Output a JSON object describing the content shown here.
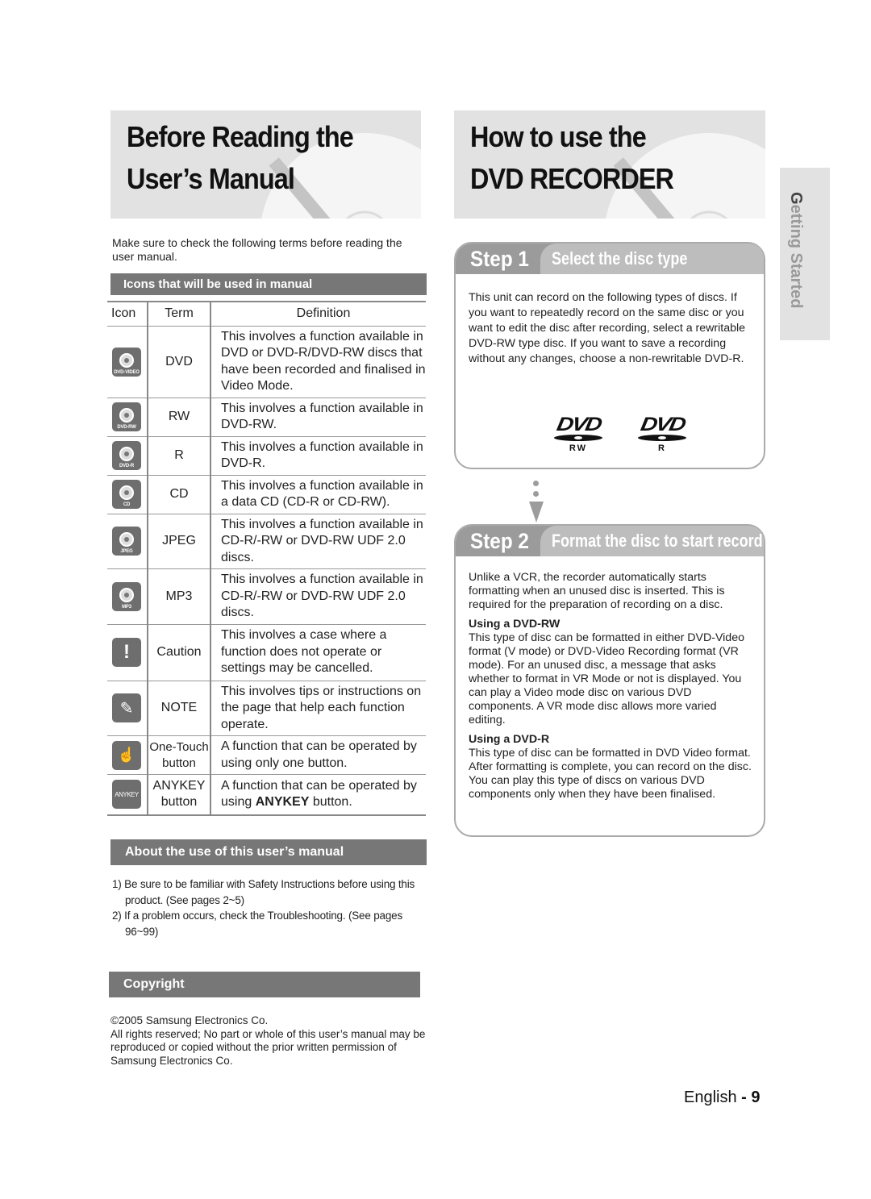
{
  "left_banner": {
    "line1": "Before Reading the",
    "line2": "User’s Manual"
  },
  "right_banner": {
    "line1": "How to use the",
    "line2": "DVD RECORDER"
  },
  "intro": "Make sure to check the following terms before reading the user manual.",
  "icons_section": {
    "title": "Icons that will be used in manual",
    "headers": {
      "icon": "Icon",
      "term": "Term",
      "definition": "Definition"
    },
    "rows": [
      {
        "icon": "dvd-video-disc-icon",
        "badge": "DVD-VIDEO",
        "term": "DVD",
        "definition": "This involves a function available in DVD or DVD-R/DVD-RW discs that have been recorded and finalised in Video Mode."
      },
      {
        "icon": "dvd-rw-disc-icon",
        "badge": "DVD-RW",
        "term": "RW",
        "definition": "This involves a function available in DVD-RW."
      },
      {
        "icon": "dvd-r-disc-icon",
        "badge": "DVD-R",
        "term": "R",
        "definition": "This involves a function available in DVD-R."
      },
      {
        "icon": "cd-disc-icon",
        "badge": "CD",
        "term": "CD",
        "definition": "This involves a function available in a data CD (CD-R or CD-RW)."
      },
      {
        "icon": "jpeg-disc-icon",
        "badge": "JPEG",
        "term": "JPEG",
        "definition": "This involves a function available in CD-R/-RW or DVD-RW UDF 2.0 discs."
      },
      {
        "icon": "mp3-disc-icon",
        "badge": "MP3",
        "term": "MP3",
        "definition": "This involves a function available in CD-R/-RW or DVD-RW UDF 2.0 discs."
      },
      {
        "icon": "caution-icon",
        "glyph": "!",
        "term": "Caution",
        "definition": "This involves a case where a function does not operate or settings may be cancelled."
      },
      {
        "icon": "note-pencil-icon",
        "glyph": "✎",
        "term": "NOTE",
        "definition": "This involves tips or instructions on the page that help each function operate."
      },
      {
        "icon": "one-touch-hand-icon",
        "glyph": "☝",
        "term_line1": "One-Touch",
        "term_line2": "button",
        "definition": "A function that can be operated by using only one button."
      },
      {
        "icon": "anykey-icon",
        "glyph": "ANYKEY",
        "term_line1": "ANYKEY",
        "term_line2": "button",
        "definition_pre": "A function that can be operated by using ",
        "definition_bold": "ANYKEY",
        "definition_post": " button."
      }
    ]
  },
  "about_section": {
    "title": "About the use of this user’s manual",
    "items": [
      "1) Be sure to be familiar with Safety Instructions before using this product. (See pages 2~5)",
      "2) If a problem occurs, check the Troubleshooting. (See pages 96~99)"
    ]
  },
  "copyright_section": {
    "title": "Copyright",
    "line1": "©2005 Samsung Electronics Co.",
    "body": "All rights reserved; No part or whole of this user’s manual may be reproduced or copied without the prior written permission of Samsung Electronics Co."
  },
  "step1": {
    "label": "Step 1",
    "title": "Select the disc type",
    "body": "This unit can record on the following types of discs. If you want to repeatedly record on the same disc or you want to edit the disc after recording, select a rewritable DVD-RW type disc. If you want to save a recording without any changes, choose a non-rewritable DVD-R.",
    "logos": [
      {
        "mark": "DVD",
        "sub": "RW"
      },
      {
        "mark": "DVD",
        "sub": "R"
      }
    ]
  },
  "step2": {
    "label": "Step 2",
    "title": "Format the disc to start recording",
    "intro": "Unlike a VCR, the recorder automatically starts formatting when an unused disc is inserted. This is required for the preparation of recording on a disc.",
    "rw_heading": "Using a DVD-RW",
    "rw_body": "This type of disc can be formatted in either DVD-Video format (V mode) or DVD-Video Recording format (VR mode). For an unused disc, a message that asks whether to format in VR Mode or not is displayed. You can play a Video mode disc on various DVD components. A VR mode disc allows more varied editing.",
    "r_heading": "Using a DVD-R",
    "r_body": "This type of disc can be formatted in DVD Video format. After formatting is complete, you can record on the disc. You can play this type of discs on various DVD components only when they have been finalised."
  },
  "side_tab": {
    "first_letter": "G",
    "rest": "etting Started"
  },
  "footer": {
    "language": "English",
    "separator": " - ",
    "page": "9"
  }
}
